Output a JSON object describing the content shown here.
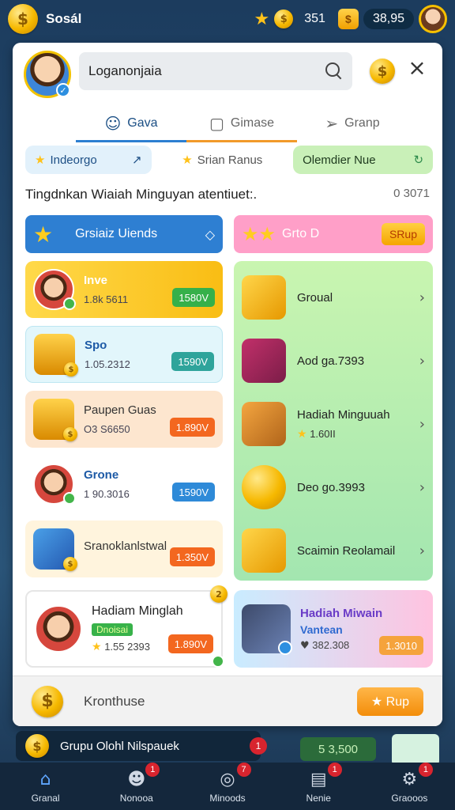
{
  "topbar": {
    "title": "Sosál",
    "stars_value": "351",
    "gift_value": "38,95"
  },
  "header": {
    "search_text": "Loganonjaia"
  },
  "tabs": [
    {
      "label": "Gava",
      "icon": "user-icon"
    },
    {
      "label": "Gimase",
      "icon": "chat-icon"
    },
    {
      "label": "Granp",
      "icon": "send-icon"
    }
  ],
  "filters": [
    {
      "label": "Indeorgo"
    },
    {
      "label": "Srian Ranus"
    },
    {
      "label": "Olemdier Nue"
    }
  ],
  "subline": {
    "text": "Tingdnkan Wiaiah Minguyan atentiuet:.",
    "value": "0 3071"
  },
  "left": {
    "header": "Grsiaiz Uiends",
    "cards": [
      {
        "title": "Inve",
        "sub": "1.8k 5611",
        "badge": "1580V"
      },
      {
        "title": "Spo",
        "sub": "1.05.2312",
        "badge": "1590V"
      },
      {
        "title": "Paupen Guas",
        "sub": "O3 S6650",
        "badge": "1.890V"
      },
      {
        "title": "Grone",
        "sub": "1 90.3016",
        "badge": "1590V"
      },
      {
        "title": "Sranoklanlstwal",
        "sub": "",
        "badge": "1.350V"
      }
    ]
  },
  "right": {
    "header": "Grto D",
    "header_button": "SRup",
    "items": [
      {
        "title": "Groual",
        "sub": ""
      },
      {
        "title": "Aod ga.7393",
        "sub": ""
      },
      {
        "title": "Hadiah Minguuah",
        "sub": "1.60II"
      },
      {
        "title": "Deo go.3993",
        "sub": ""
      },
      {
        "title": "Scaimin Reolamail",
        "sub": ""
      }
    ]
  },
  "feature_left": {
    "title": "Hadiam Minglah",
    "tag": "Dnoisai",
    "value": "1.55 2393",
    "badge": "1.890V",
    "corner": "2"
  },
  "feature_right": {
    "title": "Hadiah Miwain",
    "sub": "Vantean",
    "value": "382.308",
    "badge": "1.3010"
  },
  "footer": {
    "text": "Kronthuse",
    "button": "Rup"
  },
  "strip": {
    "text": "Grupu Olohl Nilspauek",
    "badge": "1",
    "right_value": "5 3,500"
  },
  "nav": [
    {
      "label": "Granal",
      "badge": ""
    },
    {
      "label": "Nonooa",
      "badge": "1"
    },
    {
      "label": "Minoods",
      "badge": "7"
    },
    {
      "label": "Nenie",
      "badge": "1"
    },
    {
      "label": "Graooos",
      "badge": "1"
    }
  ],
  "colors": {
    "accent_blue": "#2e7fd2",
    "pink_header": "#ff9fc8",
    "green_panel": "#bdeeb3",
    "orange_button": "#f38d0a"
  }
}
